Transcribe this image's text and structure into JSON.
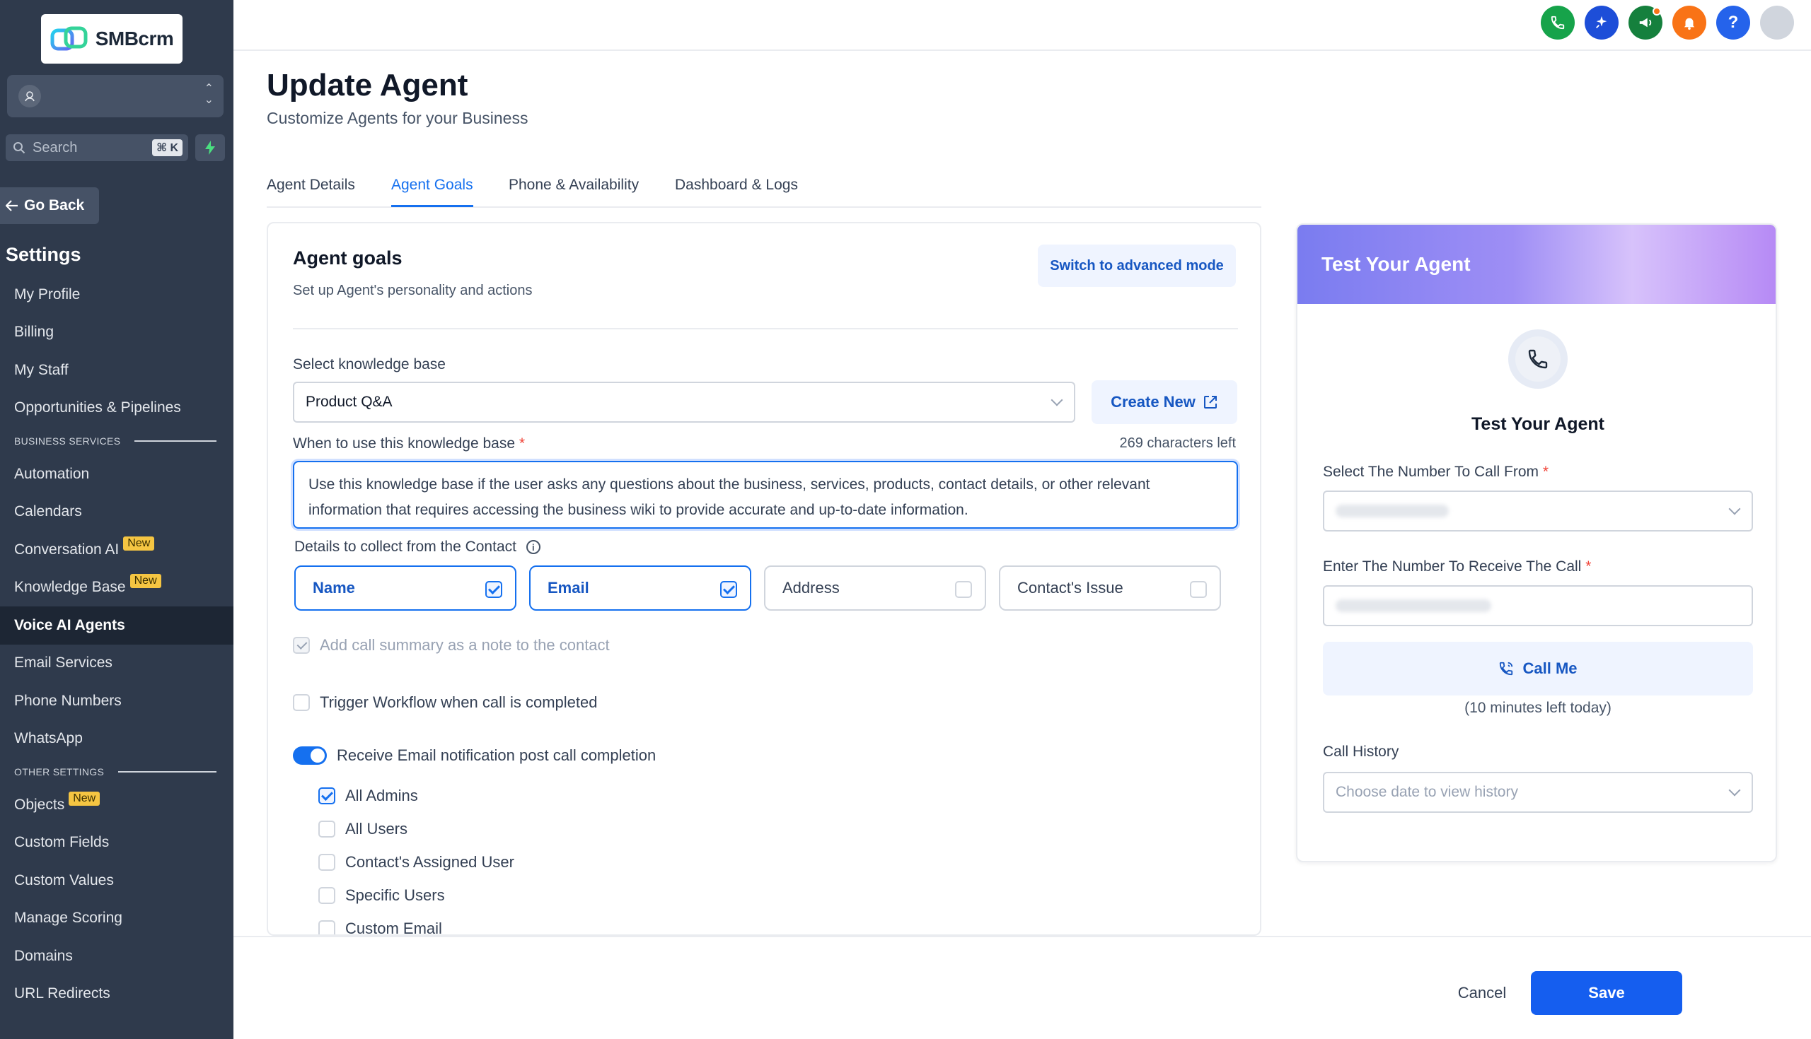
{
  "brand": {
    "name": "SMBcrm"
  },
  "sidebar": {
    "search_placeholder": "Search",
    "shortcut": "⌘ K",
    "go_back": "Go Back",
    "settings_title": "Settings",
    "items_top": [
      "My Profile",
      "Billing",
      "My Staff",
      "Opportunities & Pipelines"
    ],
    "section_business": "BUSINESS SERVICES",
    "items_business": [
      {
        "label": "Automation",
        "badge": ""
      },
      {
        "label": "Calendars",
        "badge": ""
      },
      {
        "label": "Conversation AI",
        "badge": "New"
      },
      {
        "label": "Knowledge Base",
        "badge": "New"
      },
      {
        "label": "Voice AI Agents",
        "badge": "",
        "active": true
      },
      {
        "label": "Email Services",
        "badge": ""
      },
      {
        "label": "Phone Numbers",
        "badge": ""
      },
      {
        "label": "WhatsApp",
        "badge": ""
      }
    ],
    "section_other": "OTHER SETTINGS",
    "items_other": [
      {
        "label": "Objects",
        "badge": "New"
      },
      {
        "label": "Custom Fields",
        "badge": ""
      },
      {
        "label": "Custom Values",
        "badge": ""
      },
      {
        "label": "Manage Scoring",
        "badge": ""
      },
      {
        "label": "Domains",
        "badge": ""
      },
      {
        "label": "URL Redirects",
        "badge": ""
      }
    ]
  },
  "topbar": {
    "icons": [
      {
        "name": "phone-icon",
        "color": "#16a34a"
      },
      {
        "name": "sparkle-icon",
        "color": "#1d4ed8"
      },
      {
        "name": "megaphone-icon",
        "color": "#15803d"
      },
      {
        "name": "bell-icon",
        "color": "#f97316"
      },
      {
        "name": "help-icon",
        "color": "#2563eb"
      }
    ]
  },
  "page": {
    "title": "Update Agent",
    "subtitle": "Customize Agents for your Business",
    "tabs": [
      "Agent Details",
      "Agent Goals",
      "Phone & Availability",
      "Dashboard & Logs"
    ],
    "active_tab": "Agent Goals"
  },
  "goals": {
    "title": "Agent goals",
    "subtitle": "Set up Agent's personality and actions",
    "advanced_button": "Switch to advanced mode",
    "kb_label": "Select knowledge base",
    "kb_value": "Product Q&A",
    "create_new": "Create New",
    "when_label": "When to use this knowledge base",
    "required_mark": "*",
    "chars_left": "269 characters left",
    "when_text": "Use this knowledge base if the user asks any questions about the business, services, products, contact details, or other relevant information that requires accessing the business wiki to provide accurate and up-to-date information.",
    "details_label": "Details to collect from the Contact",
    "contact_fields": [
      {
        "label": "Name",
        "checked": true
      },
      {
        "label": "Email",
        "checked": true
      },
      {
        "label": "Address",
        "checked": false
      },
      {
        "label": "Contact's Issue",
        "checked": false
      }
    ],
    "call_summary": "Add call summary as a note to the contact",
    "trigger_workflow": "Trigger Workflow when call is completed",
    "email_notification": "Receive Email notification post call completion",
    "recipients": [
      {
        "label": "All Admins",
        "checked": true
      },
      {
        "label": "All Users",
        "checked": false
      },
      {
        "label": "Contact's Assigned User",
        "checked": false
      },
      {
        "label": "Specific Users",
        "checked": false
      },
      {
        "label": "Custom Email",
        "checked": false
      }
    ]
  },
  "test": {
    "header": "Test Your Agent",
    "title": "Test Your Agent",
    "from_label": "Select The Number To Call From",
    "to_label": "Enter The Number To Receive The Call",
    "required_mark": "*",
    "call_button": "Call Me",
    "minutes_left": "(10 minutes left today)",
    "history_label": "Call History",
    "history_placeholder": "Choose date to view history"
  },
  "footer": {
    "cancel": "Cancel",
    "save": "Save"
  }
}
